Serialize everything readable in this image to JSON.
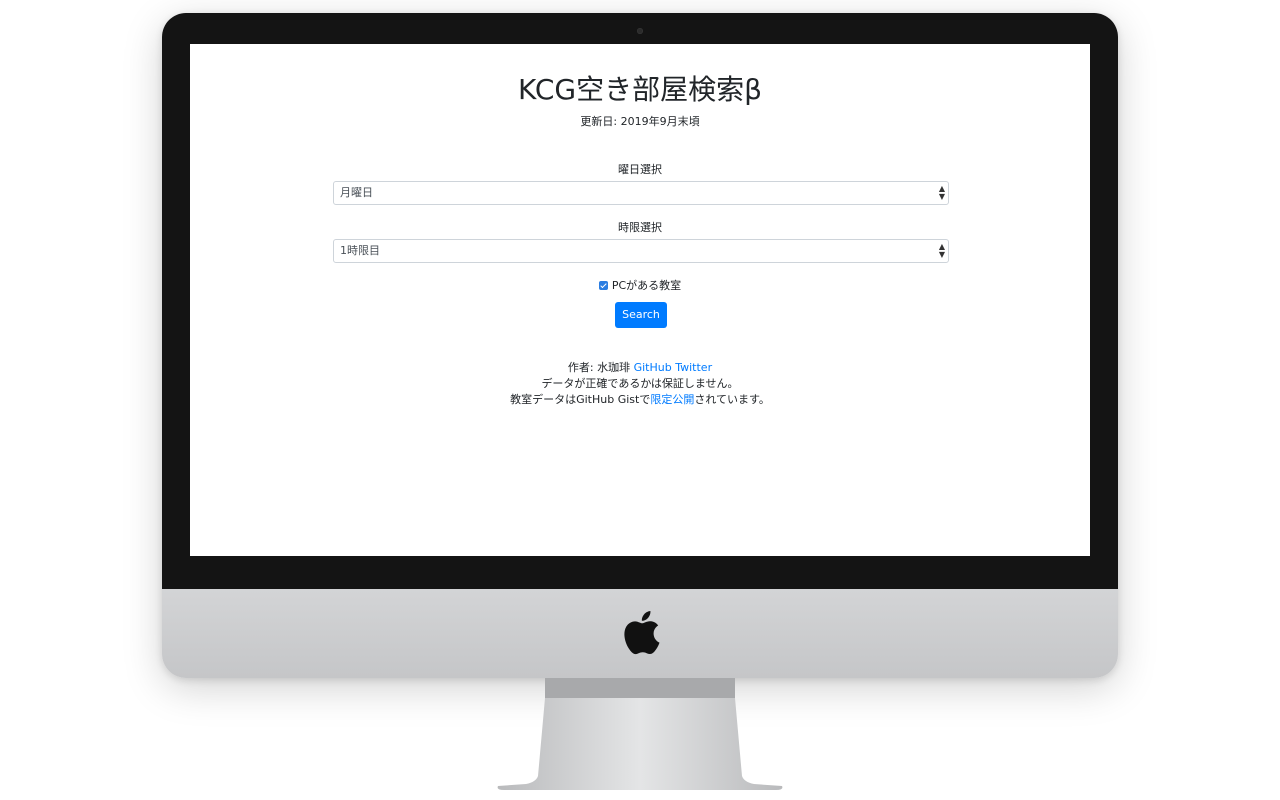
{
  "app": {
    "title": "KCG空き部屋検索β",
    "updated": "更新日: 2019年9月末頃"
  },
  "form": {
    "day_label": "曜日選択",
    "day_value": "月曜日",
    "period_label": "時限選択",
    "period_value": "1時限目",
    "pc_checkbox_label": "PCがある教室",
    "pc_checkbox_checked": true,
    "search_button": "Search"
  },
  "footer": {
    "author_prefix": "作者: 水珈琲",
    "github_link": "GitHub",
    "twitter_link": "Twitter",
    "disclaimer": "データが正確であるかは保証しません。",
    "data_prefix": "教室データはGitHub Gistで",
    "data_link": "限定公開",
    "data_suffix": "されています。"
  },
  "colors": {
    "primary": "#007bff",
    "text": "#212529",
    "bezel": "#141414",
    "chin": "#c8c9cb"
  },
  "icons": {
    "select_caret": "updown-caret-icon",
    "device_logo": "apple-logo-icon",
    "checkbox": "checkmark-icon"
  }
}
